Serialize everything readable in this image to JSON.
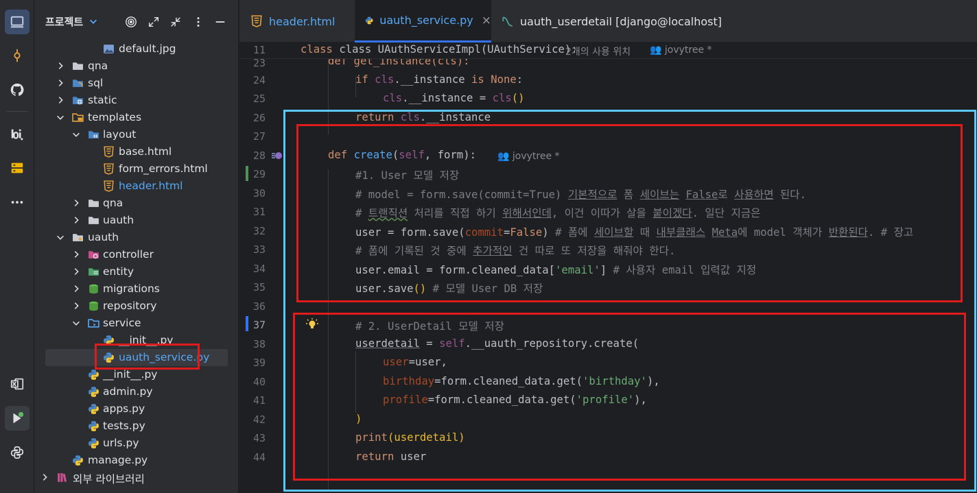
{
  "project_panel": {
    "title": "프로젝트",
    "tree": [
      {
        "label": "default.jpg",
        "kind": "image"
      },
      {
        "label": "qna",
        "kind": "folder"
      },
      {
        "label": "sql",
        "kind": "sql-folder"
      },
      {
        "label": "static",
        "kind": "web-folder"
      },
      {
        "label": "templates",
        "kind": "templates-folder"
      },
      {
        "label": "layout",
        "kind": "layout-folder"
      },
      {
        "label": "base.html",
        "kind": "html"
      },
      {
        "label": "form_errors.html",
        "kind": "html"
      },
      {
        "label": "header.html",
        "kind": "html"
      },
      {
        "label": "qna",
        "kind": "folder"
      },
      {
        "label": "uauth",
        "kind": "folder"
      },
      {
        "label": "uauth",
        "kind": "folder"
      },
      {
        "label": "controller",
        "kind": "controller-folder"
      },
      {
        "label": "entity",
        "kind": "entity-folder"
      },
      {
        "label": "migrations",
        "kind": "db-folder"
      },
      {
        "label": "repository",
        "kind": "db-folder"
      },
      {
        "label": "service",
        "kind": "service-folder"
      },
      {
        "label": "__init__.py",
        "kind": "python"
      },
      {
        "label": "uauth_service.py",
        "kind": "python"
      },
      {
        "label": "__init__.py",
        "kind": "python"
      },
      {
        "label": "admin.py",
        "kind": "python"
      },
      {
        "label": "apps.py",
        "kind": "python"
      },
      {
        "label": "tests.py",
        "kind": "python"
      },
      {
        "label": "urls.py",
        "kind": "python"
      },
      {
        "label": "manage.py",
        "kind": "python"
      },
      {
        "label": "외부 라이브러리",
        "kind": "library"
      }
    ]
  },
  "tabs": [
    {
      "label": "header.html",
      "icon": "html-icon"
    },
    {
      "label": "uauth_service.py",
      "icon": "python-icon",
      "close": "×"
    },
    {
      "label": "uauth_userdetail [django@localhost]",
      "icon": "table-icon"
    }
  ],
  "editor": {
    "sticky": {
      "line": "11",
      "code": "class UAuthServiceImpl(UAuthService):",
      "usages": "2개의 사용 위치",
      "author": "jovytree *"
    },
    "author_hint": "jovytree *",
    "lines": [
      "23",
      "24",
      "25",
      "26",
      "27",
      "28",
      "29",
      "30",
      "31",
      "32",
      "33",
      "34",
      "35",
      "36",
      "37",
      "38",
      "39",
      "40",
      "41",
      "42",
      "43",
      "44"
    ],
    "code": {
      "l23": "def get_instance(cls):",
      "l24_if": "if",
      "l24_cls": "cls",
      "l24_rest": ".__instance",
      "l24_is": "is",
      "l24_none": "None",
      "l25_cls": "cls",
      "l25_mid": ".__instance = ",
      "l25_cls2": "cls",
      "l26_ret": "return",
      "l26_cls": "cls",
      "l26_rest": ".__instance",
      "l28_def": "def",
      "l28_fn": "create",
      "l28_self": "self",
      "l28_rest": ", form):",
      "l29": "#1. User 모델 저장",
      "l30a": "# model = form.save(commit=True) ",
      "l30b": "기본적으로",
      "l30c": " 폼 ",
      "l30d": "세이브는",
      "l30e": " ",
      "l30f": "False",
      "l30g": "로 ",
      "l30h": "사용하면",
      "l30i": " 된다.",
      "l31a": "# ",
      "l31b": "트랜직션",
      "l31c": " 처리를 직접 하기 ",
      "l31d": "위해서인데",
      "l31e": ", 이건 이따가 살을 ",
      "l31f": "붙이겠다",
      "l31g": ". 일단 지금은",
      "l32a": "user = form.save(",
      "l32b": "commit",
      "l32c": "=",
      "l32d": "False",
      "l32e": ") ",
      "l32f": "# 폼에 ",
      "l32g": "세이브할",
      "l32h": " 때 ",
      "l32i": "내부클래스",
      "l32j": " ",
      "l32k": "Meta",
      "l32l": "에 model 객체가 ",
      "l32m": "반환된다",
      "l32n": ". # 장고 ",
      "l33a": "# 폼에 기록된 것 중에 ",
      "l33b": "추가적인",
      "l33c": " 건 따로 또 저장을 해줘야 한다.",
      "l34a": "user.email = form.cleaned_data[",
      "l34b": "'email'",
      "l34c": "] ",
      "l34d": "# 사용자 email 입력값 지정",
      "l35a": "user.save",
      "l35b": "() ",
      "l35c": "# 모델 User DB 저장",
      "l37": "# 2. UserDetail 모델 저장",
      "l38a": "userdetail",
      "l38b": " = ",
      "l38c": "self",
      "l38d": ".__uauth_repository.create(",
      "l39a": "user",
      "l39b": "=user,",
      "l40a": "birthday",
      "l40b": "=form.cleaned_data.get(",
      "l40c": "'birthday'",
      "l40d": "),",
      "l41a": "profile",
      "l41b": "=form.cleaned_data.get(",
      "l41c": "'profile'",
      "l41d": "),",
      "l42": ")",
      "l43a": "print",
      "l43b": "(userdetail)",
      "l44a": "return",
      "l44b": " user"
    }
  },
  "colors": {
    "highlight_red": "#e01b1b",
    "highlight_blue": "#5bc8f5",
    "accent": "#3574f0"
  }
}
